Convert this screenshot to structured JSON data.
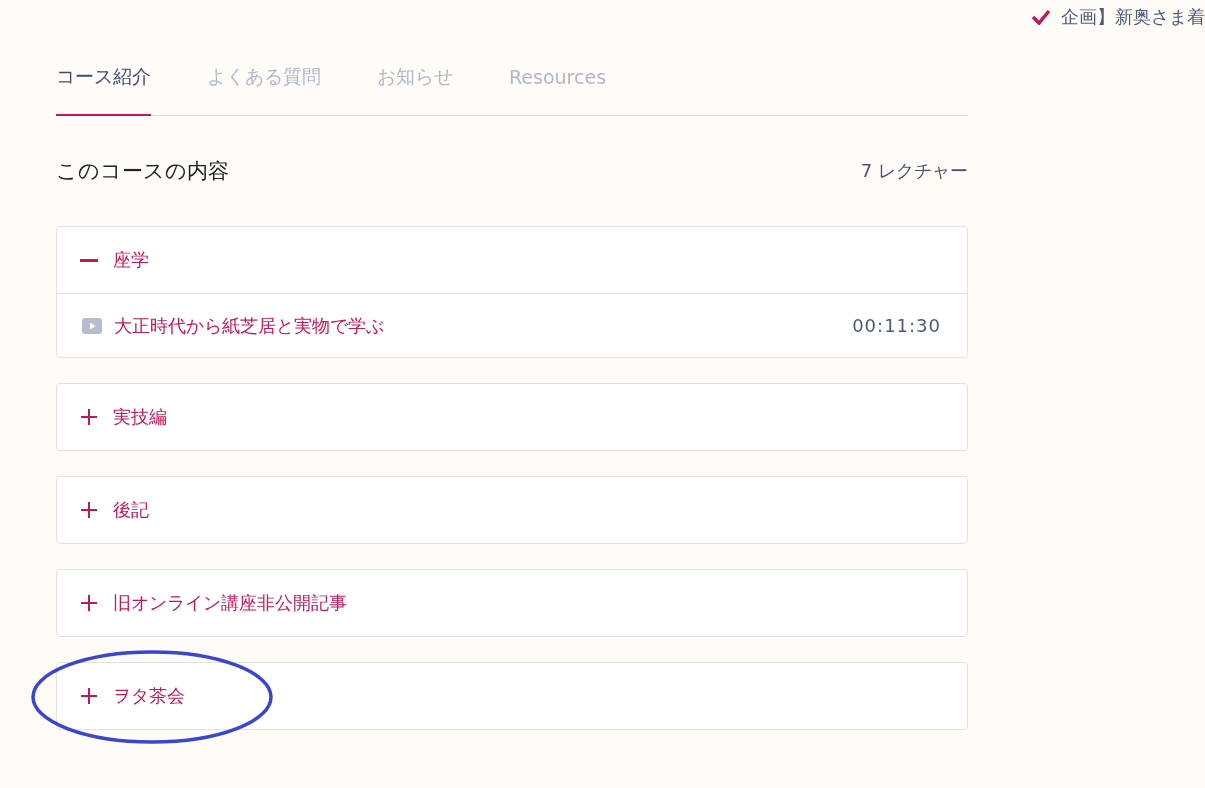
{
  "notice": {
    "text": "企画】新奥さま着",
    "checked": true
  },
  "tabs": [
    {
      "label": "コース紹介",
      "selected": true
    },
    {
      "label": "よくある質問",
      "selected": false
    },
    {
      "label": "お知らせ",
      "selected": false
    },
    {
      "label": "Resources",
      "selected": false
    }
  ],
  "content": {
    "heading": "このコースの内容",
    "count": "7 レクチャー"
  },
  "sections": [
    {
      "title": "座学",
      "expanded": true,
      "lectures": [
        {
          "title": "大正時代から紙芝居と実物で学ぶ",
          "duration": "00:11:30"
        }
      ]
    },
    {
      "title": "実技編",
      "expanded": false
    },
    {
      "title": "後記",
      "expanded": false
    },
    {
      "title": "旧オンライン講座非公開記事",
      "expanded": false
    },
    {
      "title": "ヲタ茶会",
      "expanded": false,
      "circled": true
    }
  ]
}
